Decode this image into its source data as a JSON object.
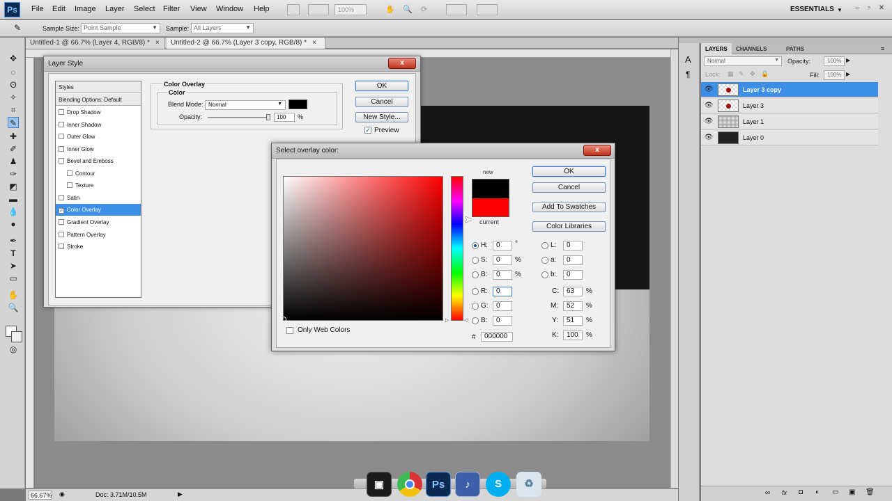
{
  "app": {
    "logo": "Ps",
    "menu": [
      "File",
      "Edit",
      "Image",
      "Layer",
      "Select",
      "Filter",
      "View",
      "Window",
      "Help"
    ],
    "zoom_field": "100%",
    "workspace": "ESSENTIALS"
  },
  "options_bar": {
    "sample_size_label": "Sample Size:",
    "sample_size_value": "Point Sample",
    "sample_label": "Sample:",
    "sample_value": "All Layers"
  },
  "doc_tabs": [
    {
      "label": "Untitled-1 @ 66.7% (Layer 4, RGB/8) *",
      "close": "×"
    },
    {
      "label": "Untitled-2 @ 66.7% (Layer 3 copy, RGB/8) *",
      "close": "×"
    }
  ],
  "status_bar": {
    "zoom": "66.67%",
    "doc": "Doc: 3.71M/10.5M"
  },
  "layers_panel": {
    "tabs": [
      "LAYERS",
      "CHANNELS",
      "PATHS"
    ],
    "blend_mode": "Normal",
    "opacity_label": "Opacity:",
    "opacity_value": "100%",
    "lock_label": "Lock:",
    "fill_label": "Fill:",
    "fill_value": "100%",
    "layers": [
      {
        "name": "Layer 3 copy",
        "selected": true
      },
      {
        "name": "Layer 3",
        "selected": false
      },
      {
        "name": "Layer 1",
        "selected": false
      },
      {
        "name": "Layer 0",
        "selected": false
      }
    ]
  },
  "layer_style": {
    "title": "Layer Style",
    "close": "x",
    "styles_header": "Styles",
    "blending_options": "Blending Options: Default",
    "items": [
      {
        "label": "Drop Shadow",
        "checked": false,
        "indent": false
      },
      {
        "label": "Inner Shadow",
        "checked": false,
        "indent": false
      },
      {
        "label": "Outer Glow",
        "checked": false,
        "indent": false
      },
      {
        "label": "Inner Glow",
        "checked": false,
        "indent": false
      },
      {
        "label": "Bevel and Emboss",
        "checked": false,
        "indent": false
      },
      {
        "label": "Contour",
        "checked": false,
        "indent": true
      },
      {
        "label": "Texture",
        "checked": false,
        "indent": true
      },
      {
        "label": "Satin",
        "checked": false,
        "indent": false
      },
      {
        "label": "Color Overlay",
        "checked": true,
        "indent": false
      },
      {
        "label": "Gradient Overlay",
        "checked": false,
        "indent": false
      },
      {
        "label": "Pattern Overlay",
        "checked": false,
        "indent": false
      },
      {
        "label": "Stroke",
        "checked": false,
        "indent": false
      }
    ],
    "section_title": "Color Overlay",
    "group_title": "Color",
    "blend_mode_label": "Blend Mode:",
    "blend_mode_value": "Normal",
    "opacity_label": "Opacity:",
    "opacity_value": "100",
    "opacity_unit": "%",
    "ok": "OK",
    "cancel": "Cancel",
    "new_style": "New Style...",
    "preview": "Preview",
    "overlay_color": "#000000"
  },
  "color_picker": {
    "title": "Select overlay color:",
    "close": "x",
    "new_label": "new",
    "current_label": "current",
    "new_color": "#000000",
    "current_color": "#ff0000",
    "ok": "OK",
    "cancel": "Cancel",
    "add_to_swatches": "Add To Swatches",
    "color_libraries": "Color Libraries",
    "only_web_colors": "Only Web Colors",
    "hsb": [
      {
        "label": "H:",
        "value": "0",
        "unit": "°",
        "selected": true
      },
      {
        "label": "S:",
        "value": "0",
        "unit": "%",
        "selected": false
      },
      {
        "label": "B:",
        "value": "0",
        "unit": "%",
        "selected": false
      }
    ],
    "rgb": [
      {
        "label": "R:",
        "value": "0"
      },
      {
        "label": "G:",
        "value": "0"
      },
      {
        "label": "B:",
        "value": "0"
      }
    ],
    "lab": [
      {
        "label": "L:",
        "value": "0"
      },
      {
        "label": "a:",
        "value": "0"
      },
      {
        "label": "b:",
        "value": "0"
      }
    ],
    "cmyk": [
      {
        "label": "C:",
        "value": "63",
        "unit": "%"
      },
      {
        "label": "M:",
        "value": "52",
        "unit": "%"
      },
      {
        "label": "Y:",
        "value": "51",
        "unit": "%"
      },
      {
        "label": "K:",
        "value": "100",
        "unit": "%"
      }
    ],
    "hash": "#",
    "hex": "000000"
  }
}
